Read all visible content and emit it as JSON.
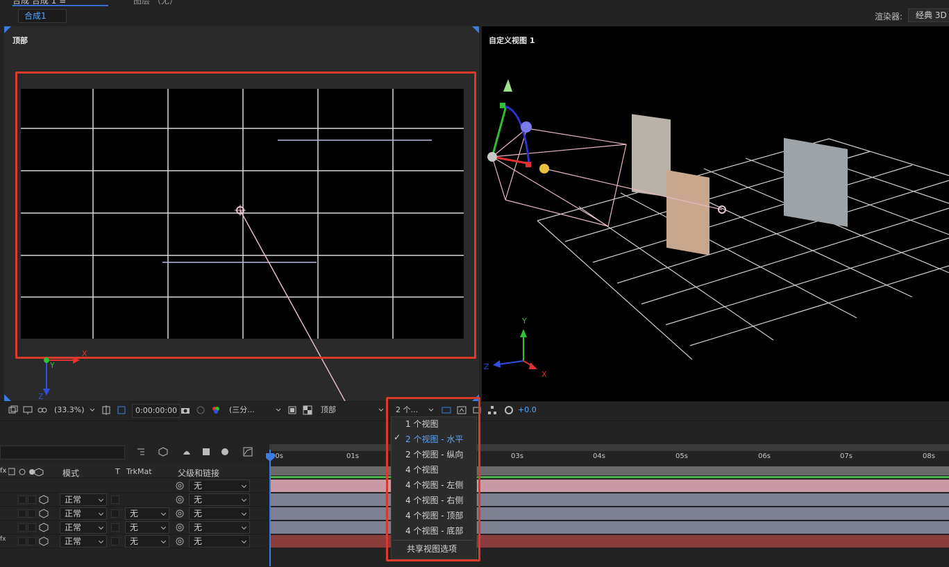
{
  "header": {
    "comp_tab": "合成 合成 1 ≡",
    "layer_label": "图层 （无）",
    "breadcrumb": "合成1",
    "renderer_label": "渲染器:",
    "renderer_value": "经典 3D"
  },
  "left_view": {
    "label": "顶部",
    "axis_x": "X",
    "axis_y": "Y",
    "axis_z": "Z"
  },
  "right_view": {
    "label": "自定义视图 1",
    "axis_x": "X",
    "axis_y": "Y",
    "axis_z": "Z"
  },
  "toolbar": {
    "zoom": "(33.3%)",
    "timecode": "0:00:00:00",
    "resolution": "(三分...",
    "view_select": "顶部",
    "layout_select": "2 个...",
    "exposure": "+0.0"
  },
  "view_menu": {
    "items": [
      {
        "label": "1 个视图",
        "checked": false
      },
      {
        "label": "2 个视图 - 水平",
        "checked": true
      },
      {
        "label": "2 个视图 - 纵向",
        "checked": false
      },
      {
        "label": "4 个视图",
        "checked": false
      },
      {
        "label": "4 个视图 - 左侧",
        "checked": false
      },
      {
        "label": "4 个视图 - 右侧",
        "checked": false
      },
      {
        "label": "4 个视图 - 顶部",
        "checked": false
      },
      {
        "label": "4 个视图 - 底部",
        "checked": false
      }
    ],
    "shared_option": "共享视图选项",
    "check_mark": "✓"
  },
  "timeline": {
    "headers": {
      "fx": "fx",
      "mode": "模式",
      "t": "T",
      "trkmat": "TrkMat",
      "parent": "父级和链接"
    },
    "ruler_labels": [
      "00s",
      "01s",
      "03s",
      "04s",
      "05s",
      "06s",
      "07s",
      "08s"
    ],
    "rows": [
      {
        "mode": "",
        "trkmat": "",
        "parent": "无",
        "fx": ""
      },
      {
        "mode": "正常",
        "trkmat": "",
        "parent": "无",
        "fx": ""
      },
      {
        "mode": "正常",
        "trkmat": "无",
        "parent": "无",
        "fx": ""
      },
      {
        "mode": "正常",
        "trkmat": "无",
        "parent": "无",
        "fx": ""
      },
      {
        "mode": "正常",
        "trkmat": "无",
        "parent": "无",
        "fx": "fx"
      }
    ],
    "bar_colors": [
      "#c79aa6",
      "#7d7f93",
      "#7d7f93",
      "#7d7f93",
      "#8a3c3c"
    ]
  },
  "colors": {
    "accent_blue": "#3a7de0",
    "highlight_red": "#d93a2b"
  }
}
